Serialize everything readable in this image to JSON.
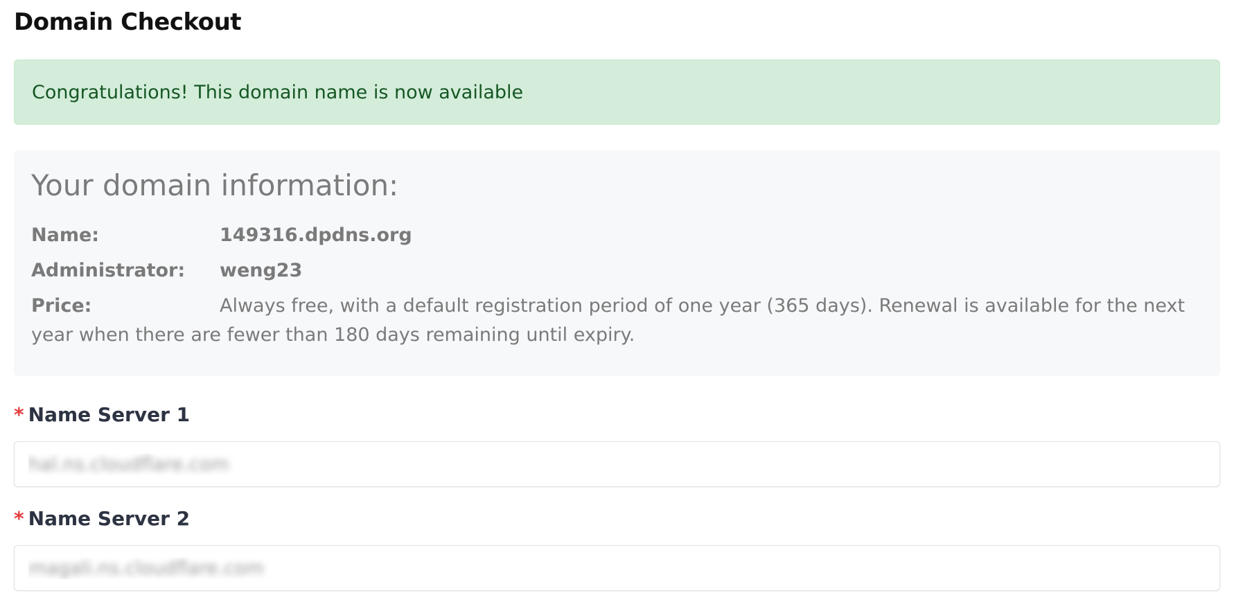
{
  "page": {
    "title": "Domain Checkout"
  },
  "alert": {
    "message": "Congratulations! This domain name is now available"
  },
  "domain_info": {
    "heading": "Your domain information:",
    "name_label": "Name:",
    "name_value": "149316.dpdns.org",
    "admin_label": "Administrator:",
    "admin_value": "weng23",
    "price_label": "Price:",
    "price_value": "Always free, with a default registration period of one year (365 days). Renewal is available for the next year when there are fewer than 180 days remaining until expiry."
  },
  "form": {
    "required_marker": "*",
    "ns1_label": "Name Server 1",
    "ns1_value": "hal.ns.cloudflare.com",
    "ns2_label": "Name Server 2",
    "ns2_value": "magali.ns.cloudflare.com"
  },
  "colors": {
    "alert_bg": "#d4edda",
    "alert_text": "#155724",
    "required": "#e53e3e",
    "card_bg": "#f7f8fa"
  }
}
